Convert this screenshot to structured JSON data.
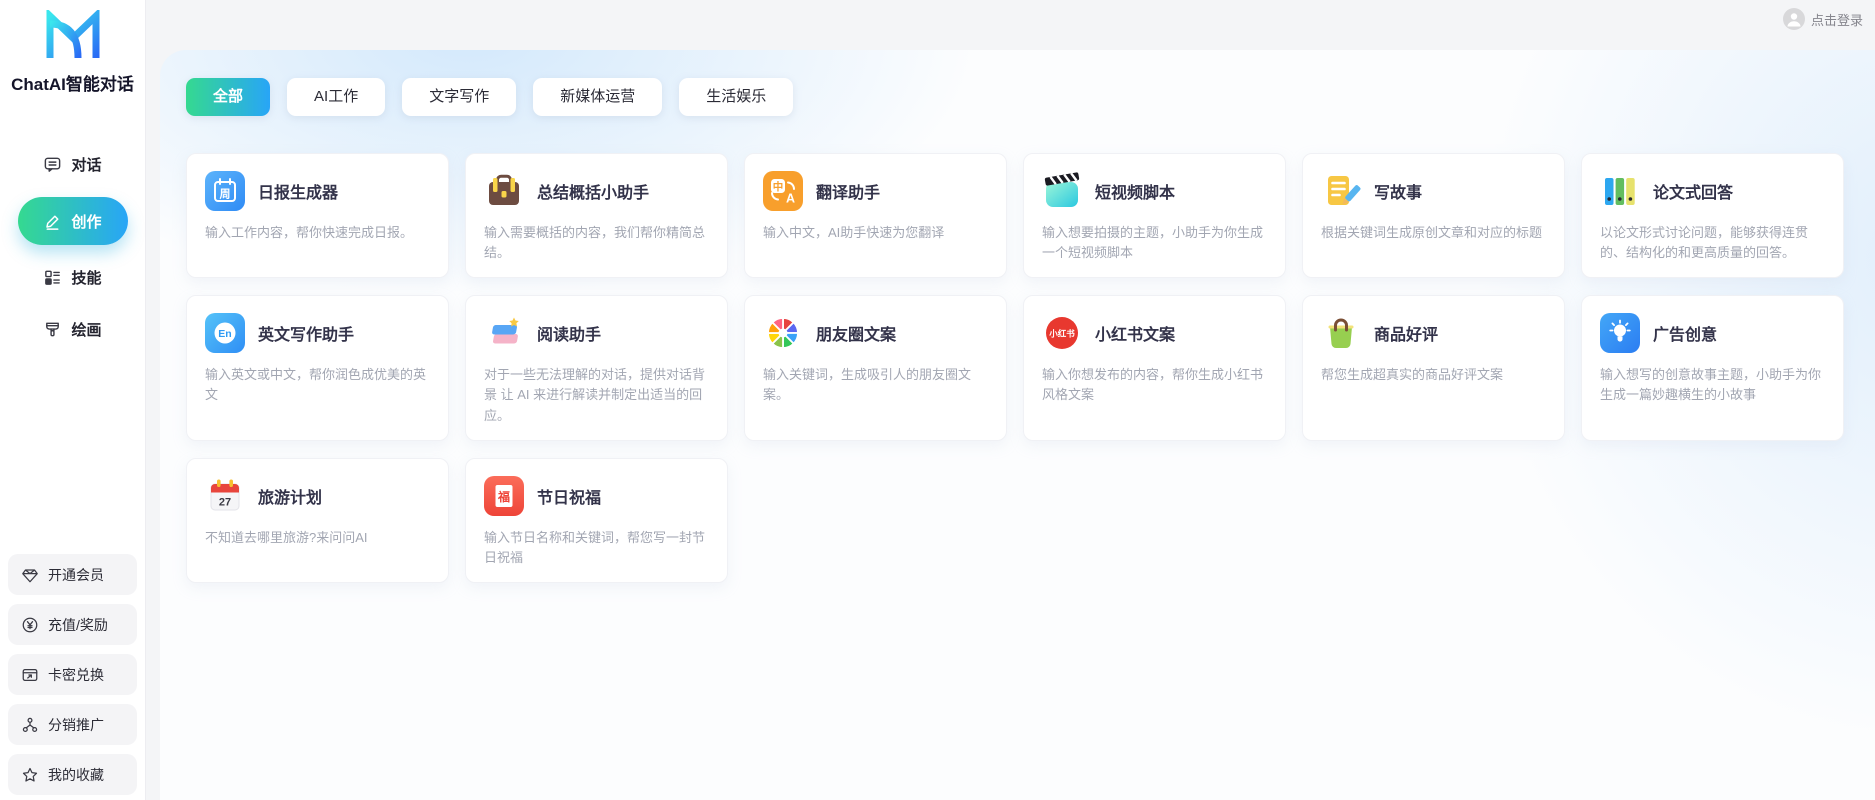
{
  "app": {
    "title": "ChatAI智能对话"
  },
  "header": {
    "login_label": "点击登录"
  },
  "colors": {
    "accent_gradient_start": "#35d990",
    "accent_gradient_end": "#28a5f7",
    "logo_gradient_start": "#3ae6ed",
    "logo_gradient_end": "#2a6af5",
    "page_background": "#f4f5f7",
    "card_background": "#ffffff",
    "title_text": "#33334a",
    "desc_text": "#a2a6b2"
  },
  "sidebar": {
    "nav": [
      {
        "key": "chat",
        "label": "对话",
        "active": false
      },
      {
        "key": "create",
        "label": "创作",
        "active": true
      },
      {
        "key": "skills",
        "label": "技能",
        "active": false
      },
      {
        "key": "paint",
        "label": "绘画",
        "active": false
      }
    ],
    "footer": [
      {
        "key": "vip",
        "label": "开通会员"
      },
      {
        "key": "recharge",
        "label": "充值/奖励"
      },
      {
        "key": "redeem",
        "label": "卡密兑换"
      },
      {
        "key": "affiliate",
        "label": "分销推广"
      },
      {
        "key": "favorites",
        "label": "我的收藏"
      }
    ]
  },
  "tabs": [
    {
      "key": "all",
      "label": "全部",
      "active": true
    },
    {
      "key": "ai-work",
      "label": "AI工作",
      "active": false
    },
    {
      "key": "writing",
      "label": "文字写作",
      "active": false
    },
    {
      "key": "media",
      "label": "新媒体运营",
      "active": false
    },
    {
      "key": "life",
      "label": "生活娱乐",
      "active": false
    }
  ],
  "cards": [
    {
      "key": "daily-report",
      "title": "日报生成器",
      "desc": "输入工作内容，帮你快速完成日报。"
    },
    {
      "key": "summary",
      "title": "总结概括小助手",
      "desc": "输入需要概括的内容，我们帮你精简总结。"
    },
    {
      "key": "translate",
      "title": "翻译助手",
      "desc": "输入中文，AI助手快速为您翻译"
    },
    {
      "key": "short-video",
      "title": "短视频脚本",
      "desc": "输入想要拍摄的主题，小助手为你生成一个短视频脚本"
    },
    {
      "key": "write-story",
      "title": "写故事",
      "desc": "根据关键词生成原创文章和对应的标题"
    },
    {
      "key": "essay-answer",
      "title": "论文式回答",
      "desc": "以论文形式讨论问题，能够获得连贯的、结构化的和更高质量的回答。"
    },
    {
      "key": "english-writing",
      "title": "英文写作助手",
      "desc": "输入英文或中文，帮你润色成优美的英文"
    },
    {
      "key": "reading",
      "title": "阅读助手",
      "desc": "对于一些无法理解的对话，提供对话背景 让 AI 来进行解读并制定出适当的回应。"
    },
    {
      "key": "moments",
      "title": "朋友圈文案",
      "desc": "输入关键词，生成吸引人的朋友圈文案。"
    },
    {
      "key": "xiaohongshu",
      "title": "小红书文案",
      "desc": "输入你想发布的内容，帮你生成小红书风格文案"
    },
    {
      "key": "good-review",
      "title": "商品好评",
      "desc": "帮您生成超真实的商品好评文案"
    },
    {
      "key": "ad-creative",
      "title": "广告创意",
      "desc": "输入想写的创意故事主题，小助手为你生成一篇妙趣横生的小故事"
    },
    {
      "key": "travel-plan",
      "title": "旅游计划",
      "desc": "不知道去哪里旅游?来问问AI"
    },
    {
      "key": "festival",
      "title": "节日祝福",
      "desc": "输入节日名称和关键词，帮您写一封节日祝福"
    }
  ]
}
